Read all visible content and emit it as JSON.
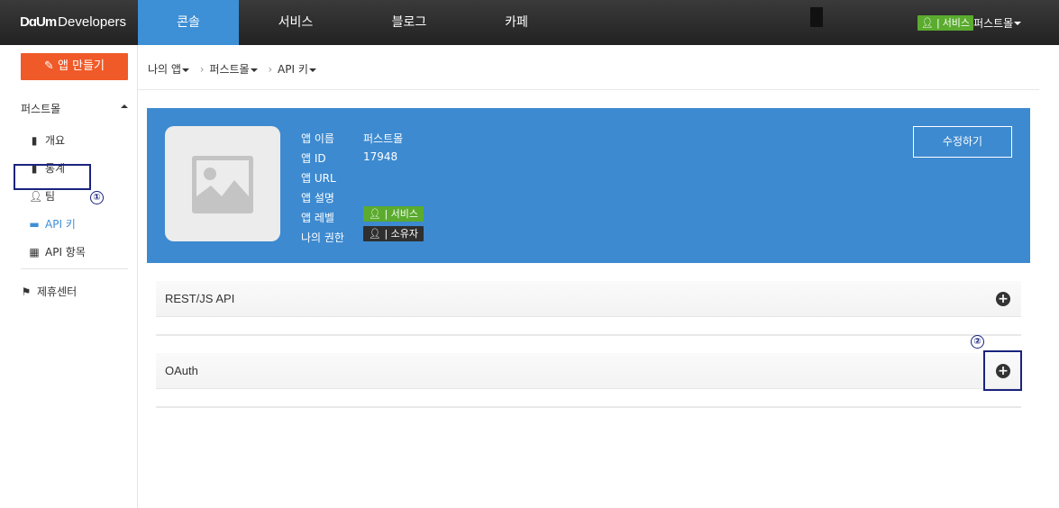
{
  "topnav": {
    "logo_daum": "D𝐚𝐔m",
    "logo_text": "Developers",
    "tabs": [
      {
        "label": "콘솔",
        "active": true
      },
      {
        "label": "서비스",
        "active": false
      },
      {
        "label": "블로그",
        "active": false
      },
      {
        "label": "카페",
        "active": false
      }
    ],
    "user_badge": "서비스",
    "user_name": "퍼스트몰"
  },
  "sidebar": {
    "make_app_label": "앱 만들기",
    "heading": "퍼스트몰",
    "items": [
      {
        "label": "개요",
        "icon": "document-icon"
      },
      {
        "label": "통계",
        "icon": "bar-chart-icon"
      },
      {
        "label": "팀",
        "icon": "user-icon"
      },
      {
        "label": "API 키",
        "icon": "card-icon",
        "active": true
      },
      {
        "label": "API 항목",
        "icon": "grid-icon"
      }
    ],
    "partner_label": "제휴센터"
  },
  "breadcrumb": {
    "items": [
      "나의 앱",
      "퍼스트몰",
      "API 키"
    ]
  },
  "app_panel": {
    "labels": {
      "name": "앱 이름",
      "id": "앱 ID",
      "url": "앱 URL",
      "desc": "앱 설명",
      "level": "앱 레벨",
      "permission": "나의 권한"
    },
    "values": {
      "name": "퍼스트몰",
      "id": "17948",
      "url": "",
      "desc": "",
      "level": "서비스",
      "permission": "소유자"
    },
    "edit_label": "수정하기"
  },
  "api_sections": [
    {
      "title": "REST/JS API"
    },
    {
      "title": "OAuth"
    }
  ],
  "annotations": {
    "one": "①",
    "two": "②"
  },
  "colors": {
    "accent": "#3d8fd6",
    "make_app": "#f05a28",
    "service_badge": "#5aab2e",
    "panel": "#3d8ad0"
  }
}
